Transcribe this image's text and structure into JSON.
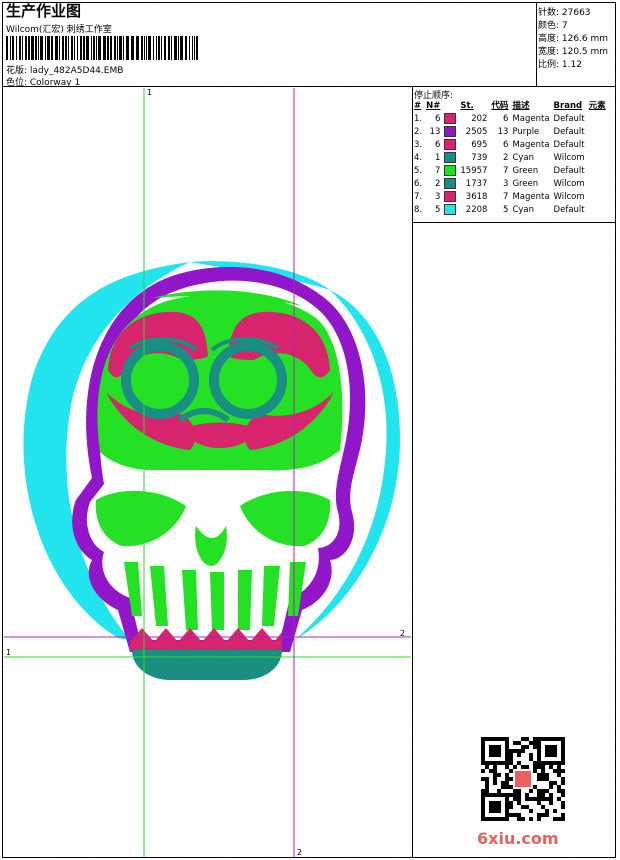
{
  "header": {
    "title": "生产作业图",
    "company": "Wilcom(汇宏) 刺绣工作室",
    "design_label": "花版: lady_482A5D44.EMB",
    "colorway_label": "色位: Colorway 1"
  },
  "stats": {
    "stitches": "针数: 27663",
    "colors": "颜色: 7",
    "height": "高度: 126.6 mm",
    "width": "宽度: 120.5 mm",
    "scale": "比例: 1.12"
  },
  "stops": {
    "title": "停止顺序:",
    "headers": [
      "#",
      "N#",
      "",
      "St.",
      "代码",
      "描述",
      "Brand",
      "元素"
    ],
    "rows": [
      {
        "idx": "1.",
        "n": "6",
        "color": "#d6206a",
        "st": "202",
        "code": "6",
        "desc": "Magenta",
        "brand": "Default"
      },
      {
        "idx": "2.",
        "n": "13",
        "color": "#8e12c8",
        "st": "2505",
        "code": "13",
        "desc": "Purple",
        "brand": "Default"
      },
      {
        "idx": "3.",
        "n": "6",
        "color": "#d6206a",
        "st": "695",
        "code": "6",
        "desc": "Magenta",
        "brand": "Default"
      },
      {
        "idx": "4.",
        "n": "1",
        "color": "#168c80",
        "st": "739",
        "code": "2",
        "desc": "Cyan",
        "brand": "Wilcom"
      },
      {
        "idx": "5.",
        "n": "7",
        "color": "#20e020",
        "st": "15957",
        "code": "7",
        "desc": "Green",
        "brand": "Default"
      },
      {
        "idx": "6.",
        "n": "2",
        "color": "#168c80",
        "st": "1737",
        "code": "3",
        "desc": "Green",
        "brand": "Wilcom"
      },
      {
        "idx": "7.",
        "n": "3",
        "color": "#d6206a",
        "st": "3618",
        "code": "7",
        "desc": "Magenta",
        "brand": "Wilcom"
      },
      {
        "idx": "8.",
        "n": "5",
        "color": "#1ee4ee",
        "st": "2208",
        "code": "5",
        "desc": "Cyan",
        "brand": "Default"
      }
    ]
  },
  "guides": {
    "label_1": "1",
    "label_2": "2"
  },
  "footer": {
    "brand": "6xiu.com"
  },
  "icons": {
    "qr": "qr-code-icon",
    "barcode": "barcode-icon"
  },
  "colors": {
    "magenta": "#d6206a",
    "purple": "#8e12c8",
    "teal": "#168c80",
    "green": "#20e020",
    "cyan": "#1ee4ee",
    "guide_green": "#33d633",
    "guide_purple": "#b020b0"
  }
}
